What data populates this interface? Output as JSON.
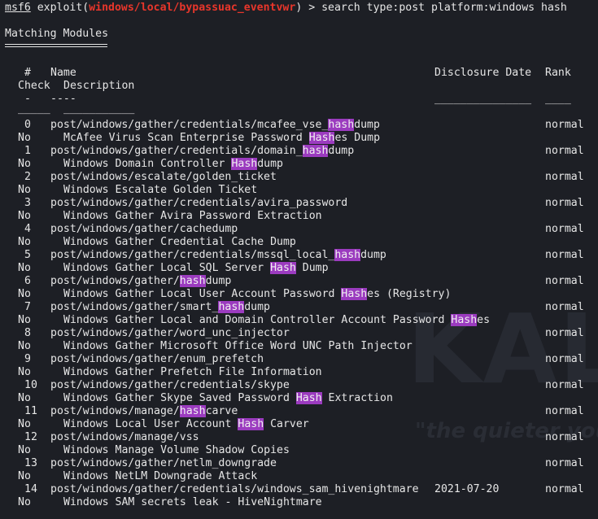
{
  "prompt": {
    "msf": "msf6",
    "exploit_prefix": " exploit(",
    "module_path": "windows/local/bypassuac_eventvwr",
    "suffix": ") > ",
    "command": "search type:post platform:windows hash"
  },
  "section_title": "Matching Modules",
  "headers": {
    "num": "#",
    "name": "Name",
    "date": "Disclosure Date",
    "rank": "Rank",
    "check": "Check",
    "description": "Description"
  },
  "underlines": {
    "num": "-",
    "name": "----",
    "date": "_______________",
    "rank": "____",
    "check": "_____",
    "description": "___________"
  },
  "modules": [
    {
      "num": "0",
      "name": [
        "post/windows/gather/credentials/mcafee_vse_",
        "hash",
        "dump"
      ],
      "date": "",
      "rank": "normal",
      "check": "No",
      "desc": [
        "McAfee Virus Scan Enterprise Password ",
        "Hash",
        "es Dump"
      ]
    },
    {
      "num": "1",
      "name": [
        "post/windows/gather/credentials/domain_",
        "hash",
        "dump"
      ],
      "date": "",
      "rank": "normal",
      "check": "No",
      "desc": [
        "Windows Domain Controller ",
        "Hash",
        "dump"
      ]
    },
    {
      "num": "2",
      "name": [
        "post/windows/escalate/golden_ticket"
      ],
      "date": "",
      "rank": "normal",
      "check": "No",
      "desc": [
        "Windows Escalate Golden Ticket"
      ]
    },
    {
      "num": "3",
      "name": [
        "post/windows/gather/credentials/avira_password"
      ],
      "date": "",
      "rank": "normal",
      "check": "No",
      "desc": [
        "Windows Gather Avira Password Extraction"
      ]
    },
    {
      "num": "4",
      "name": [
        "post/windows/gather/cachedump"
      ],
      "date": "",
      "rank": "normal",
      "check": "No",
      "desc": [
        "Windows Gather Credential Cache Dump"
      ]
    },
    {
      "num": "5",
      "name": [
        "post/windows/gather/credentials/mssql_local_",
        "hash",
        "dump"
      ],
      "date": "",
      "rank": "normal",
      "check": "No",
      "desc": [
        "Windows Gather Local SQL Server ",
        "Hash",
        " Dump"
      ]
    },
    {
      "num": "6",
      "name": [
        "post/windows/gather/",
        "hash",
        "dump"
      ],
      "date": "",
      "rank": "normal",
      "check": "No",
      "desc": [
        "Windows Gather Local User Account Password ",
        "Hash",
        "es (Registry)"
      ]
    },
    {
      "num": "7",
      "name": [
        "post/windows/gather/smart_",
        "hash",
        "dump"
      ],
      "date": "",
      "rank": "normal",
      "check": "No",
      "desc": [
        "Windows Gather Local and Domain Controller Account Password ",
        "Hash",
        "es"
      ]
    },
    {
      "num": "8",
      "name": [
        "post/windows/gather/word_unc_injector"
      ],
      "date": "",
      "rank": "normal",
      "check": "No",
      "desc": [
        "Windows Gather Microsoft Office Word UNC Path Injector"
      ]
    },
    {
      "num": "9",
      "name": [
        "post/windows/gather/enum_prefetch"
      ],
      "date": "",
      "rank": "normal",
      "check": "No",
      "desc": [
        "Windows Gather Prefetch File Information"
      ]
    },
    {
      "num": "10",
      "name": [
        "post/windows/gather/credentials/skype"
      ],
      "date": "",
      "rank": "normal",
      "check": "No",
      "desc": [
        "Windows Gather Skype Saved Password ",
        "Hash",
        " Extraction"
      ]
    },
    {
      "num": "11",
      "name": [
        "post/windows/manage/",
        "hash",
        "carve"
      ],
      "date": "",
      "rank": "normal",
      "check": "No",
      "desc": [
        "Windows Local User Account ",
        "Hash",
        " Carver"
      ]
    },
    {
      "num": "12",
      "name": [
        "post/windows/manage/vss"
      ],
      "date": "",
      "rank": "normal",
      "check": "No",
      "desc": [
        "Windows Manage Volume Shadow Copies"
      ]
    },
    {
      "num": "13",
      "name": [
        "post/windows/gather/netlm_downgrade"
      ],
      "date": "",
      "rank": "normal",
      "check": "No",
      "desc": [
        "Windows NetLM Downgrade Attack"
      ]
    },
    {
      "num": "14",
      "name": [
        "post/windows/gather/credentials/windows_sam_hivenightmare"
      ],
      "date": "2021-07-20",
      "rank": "normal",
      "check": "No",
      "desc": [
        "Windows SAM secrets leak - HiveNightmare"
      ]
    }
  ],
  "watermark": {
    "big": "KAL",
    "small": "\"the quieter you"
  },
  "colors": {
    "background": "#1d1f25",
    "text": "#e6e6e6",
    "module_red": "#e8362b",
    "highlight": "#9b3bbf"
  }
}
